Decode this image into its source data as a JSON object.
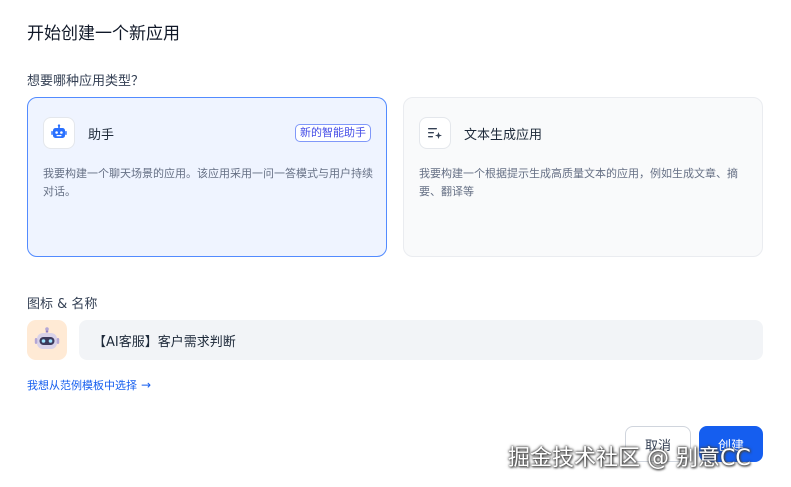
{
  "dialog": {
    "title": "开始创建一个新应用",
    "app_type_label": "想要哪种应用类型？",
    "cards": [
      {
        "name": "助手",
        "badge": "新的智能助手",
        "description": "我要构建一个聊天场景的应用。该应用采用一问一答模式与用户持续对话。",
        "icon": "robot-icon",
        "selected": true
      },
      {
        "name": "文本生成应用",
        "description": "我要构建一个根据提示生成高质量文本的应用，例如生成文章、摘要、翻译等",
        "icon": "text-sparkle-icon",
        "selected": false
      }
    ],
    "icon_name_label": "图标 & 名称",
    "app_name_value": "【AI客服】客户需求判断",
    "app_icon": "robot-emoji",
    "template_link": "我想从范例模板中选择",
    "cancel_label": "取消",
    "create_label": "创建"
  },
  "watermark": "掘金技术社区 @ 别意CC",
  "colors": {
    "accent": "#155eef",
    "selected_card_bg": "#eff4ff",
    "selected_card_border": "#528bff",
    "badge_text": "#444ce7",
    "emoji_bg": "#ffead5"
  }
}
